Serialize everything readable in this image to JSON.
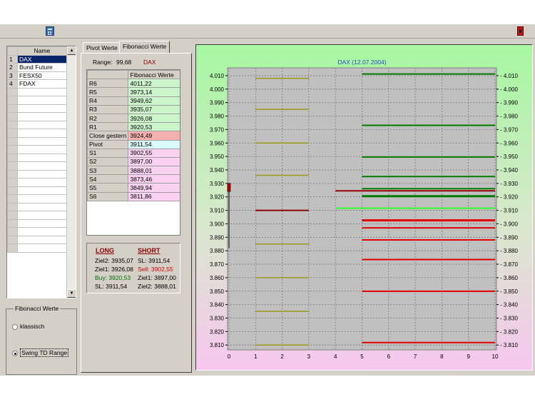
{
  "toolbar": {
    "left_icon": "calculator-icon",
    "right_icon": "exit-door-icon"
  },
  "instrument_list": {
    "header": "Name",
    "rows": [
      {
        "index": "1",
        "name": "DAX",
        "selected": true
      },
      {
        "index": "2",
        "name": "Bund Future"
      },
      {
        "index": "3",
        "name": "FESX50"
      },
      {
        "index": "4",
        "name": "FDAX"
      }
    ],
    "empty_rows": 20
  },
  "fib_mode": {
    "title": "Fibonacci Werte",
    "options": [
      {
        "label": "klassisch",
        "checked": false
      },
      {
        "label": "Swing  TD Range",
        "checked": true
      }
    ]
  },
  "tabs": [
    {
      "label": "Pivot Werte",
      "active": false
    },
    {
      "label": "Fibonacci Werte",
      "active": true
    }
  ],
  "range": {
    "label": "Range:",
    "value": "99,68",
    "symbol": "DAX"
  },
  "fib_table": {
    "header": "Fibonacci Werte",
    "rows": [
      {
        "label": "R6",
        "value": "4011,22",
        "kind": "g"
      },
      {
        "label": "R5",
        "value": "3973,14",
        "kind": "g"
      },
      {
        "label": "R4",
        "value": "3949,62",
        "kind": "g"
      },
      {
        "label": "R3",
        "value": "3935,07",
        "kind": "g"
      },
      {
        "label": "R2",
        "value": "3926,08",
        "kind": "g"
      },
      {
        "label": "R1",
        "value": "3920,53",
        "kind": "g"
      },
      {
        "label": "Close gestern",
        "value": "3924,49",
        "kind": "r"
      },
      {
        "label": "Pivot",
        "value": "3911,54",
        "kind": "c"
      },
      {
        "label": "S1",
        "value": "3902,55",
        "kind": "p"
      },
      {
        "label": "S2",
        "value": "3897,00",
        "kind": "p"
      },
      {
        "label": "S3",
        "value": "3888,01",
        "kind": "p"
      },
      {
        "label": "S4",
        "value": "3873,46",
        "kind": "p"
      },
      {
        "label": "S5",
        "value": "3849,94",
        "kind": "p"
      },
      {
        "label": "S6",
        "value": "3811,86",
        "kind": "p"
      }
    ]
  },
  "trade": {
    "long": {
      "title": "LONG",
      "ziel2": "Ziel2: 3935,07",
      "ziel1": "Ziel1: 3926,08",
      "buy": "Buy:  3920,53",
      "sl": "SL:    3911,54"
    },
    "short": {
      "title": "SHORT",
      "sl": "SL:    3911,54",
      "sell": "Sell:   3902,55",
      "ziel1": "Ziel1: 3897,00",
      "ziel2": "Ziel2: 3888,01"
    },
    "colors": {
      "title": "#8b0000",
      "buy": "#007000",
      "sell": "#d00000"
    }
  },
  "chart_data": {
    "type": "line",
    "title": "DAX     (12.07.2004)",
    "xlim": [
      0,
      10
    ],
    "ylim": [
      3805,
      4015
    ],
    "x_ticks": [
      "0",
      "1",
      "2",
      "3",
      "4",
      "5",
      "6",
      "7",
      "8",
      "9",
      "10"
    ],
    "y_ticks": [
      "4.010",
      "4.000",
      "3.990",
      "3.980",
      "3.970",
      "3.960",
      "3.950",
      "3.940",
      "3.930",
      "3.920",
      "3.910",
      "3.900",
      "3.890",
      "3.880",
      "3.870",
      "3.860",
      "3.850",
      "3.840",
      "3.830",
      "3.820",
      "3.810"
    ],
    "grid": true,
    "plot_bg": "#c0c0c0",
    "candle": {
      "x": 0,
      "low": 3882,
      "high": 3930,
      "open": 3930,
      "close": 3924
    },
    "segments": [
      {
        "x1": 1,
        "x2": 3,
        "y": 4008,
        "color": "#9a9a18",
        "width": 1.5
      },
      {
        "x1": 1,
        "x2": 3,
        "y": 3985,
        "color": "#9a9a18",
        "width": 1.5
      },
      {
        "x1": 1,
        "x2": 3,
        "y": 3960,
        "color": "#9a9a18",
        "width": 1.5
      },
      {
        "x1": 1,
        "x2": 3,
        "y": 3936,
        "color": "#9a9a18",
        "width": 1.5
      },
      {
        "x1": 1,
        "x2": 3,
        "y": 3910,
        "color": "#8b0000",
        "width": 2
      },
      {
        "x1": 1,
        "x2": 3,
        "y": 3885,
        "color": "#9a9a18",
        "width": 1.5
      },
      {
        "x1": 1,
        "x2": 3,
        "y": 3860,
        "color": "#9a9a18",
        "width": 1.5
      },
      {
        "x1": 1,
        "x2": 3,
        "y": 3835,
        "color": "#9a9a18",
        "width": 1.5
      },
      {
        "x1": 1,
        "x2": 3,
        "y": 3810,
        "color": "#9a9a18",
        "width": 1.5
      },
      {
        "x1": 4,
        "x2": 10,
        "y": 3924.49,
        "color": "#990000",
        "width": 2
      },
      {
        "x1": 4,
        "x2": 10,
        "y": 3911.54,
        "color": "#33ff33",
        "width": 2
      },
      {
        "x1": 5,
        "x2": 10,
        "y": 4011.22,
        "color": "#007a00",
        "width": 2
      },
      {
        "x1": 5,
        "x2": 10,
        "y": 3973.14,
        "color": "#007a00",
        "width": 2
      },
      {
        "x1": 5,
        "x2": 10,
        "y": 3949.62,
        "color": "#007a00",
        "width": 2
      },
      {
        "x1": 5,
        "x2": 10,
        "y": 3935.07,
        "color": "#007a00",
        "width": 2
      },
      {
        "x1": 5,
        "x2": 10,
        "y": 3926.08,
        "color": "#007a00",
        "width": 2
      },
      {
        "x1": 5,
        "x2": 10,
        "y": 3920.53,
        "color": "#007a00",
        "width": 3
      },
      {
        "x1": 5,
        "x2": 10,
        "y": 3902.55,
        "color": "#e00000",
        "width": 3
      },
      {
        "x1": 5,
        "x2": 10,
        "y": 3897.0,
        "color": "#e00000",
        "width": 2
      },
      {
        "x1": 5,
        "x2": 10,
        "y": 3888.01,
        "color": "#e00000",
        "width": 2
      },
      {
        "x1": 5,
        "x2": 10,
        "y": 3873.46,
        "color": "#e00000",
        "width": 2
      },
      {
        "x1": 5,
        "x2": 10,
        "y": 3849.94,
        "color": "#e00000",
        "width": 2
      },
      {
        "x1": 5,
        "x2": 10,
        "y": 3811.86,
        "color": "#e00000",
        "width": 2
      }
    ]
  }
}
